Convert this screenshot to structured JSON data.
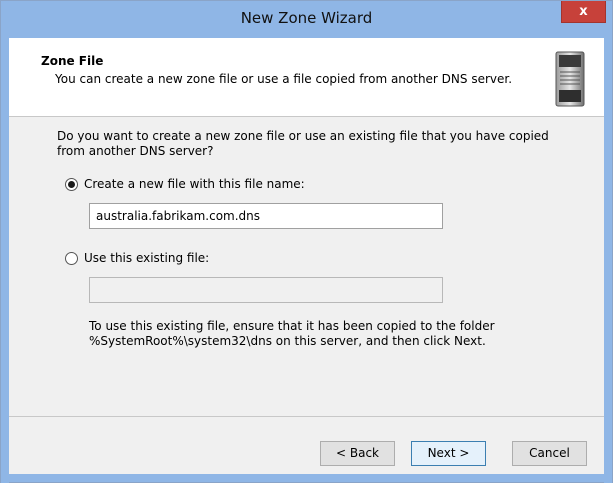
{
  "window": {
    "title": "New Zone Wizard",
    "close_label": "x"
  },
  "header": {
    "title": "Zone File",
    "description": "You can create a new zone file or use a file copied from another DNS server.",
    "icon": "server-icon"
  },
  "main": {
    "question": "Do you want to create a new zone file or use an existing file that you have copied from another DNS server?",
    "options": [
      {
        "label": "Create a new file with this file name:",
        "selected": true
      },
      {
        "label": "Use this existing file:",
        "selected": false
      }
    ],
    "new_file_value": "australia.fabrikam.com.dns",
    "existing_file_value": "",
    "note": "To use this existing file, ensure that it has been copied to the folder %SystemRoot%\\system32\\dns on this server, and then click Next."
  },
  "buttons": {
    "back": "< Back",
    "next": "Next >",
    "cancel": "Cancel"
  }
}
